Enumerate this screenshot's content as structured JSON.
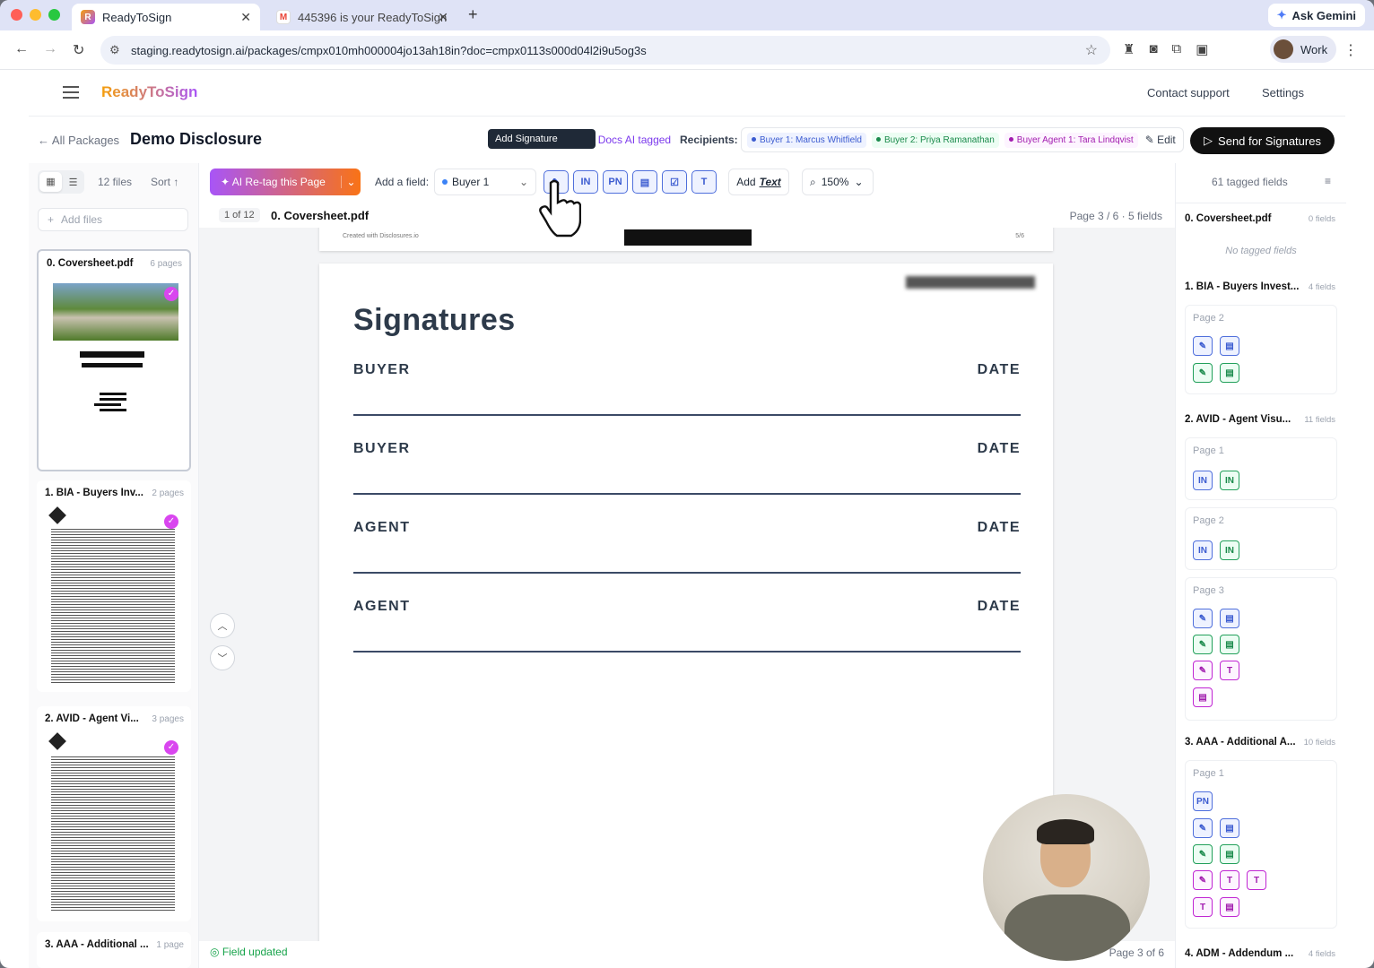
{
  "browser": {
    "tabs": [
      {
        "title": "ReadyToSign",
        "favicon": "R",
        "active": true
      },
      {
        "title": "445396 is your ReadyToSign",
        "favicon": "M",
        "active": false
      }
    ],
    "ask_gemini": "Ask Gemini",
    "url": "staging.readytosign.ai/packages/cmpx010mh000004jo13ah18in?doc=cmpx0113s000d04l2i9u5og3s",
    "profile": "Work"
  },
  "app": {
    "logo": "ReadyToSign",
    "contact_support": "Contact support",
    "settings": "Settings",
    "back_link": "All Packages",
    "package_title": "Demo Disclosure",
    "ai_tagged": "12/12 Docs AI tagged",
    "recipients_label": "Recipients:",
    "recipients": [
      {
        "label": "Buyer 1: Marcus Whitfield",
        "color": "#3b5bd0",
        "bg": "#eef2ff"
      },
      {
        "label": "Buyer 2: Priya Ramanathan",
        "color": "#1a8a4b",
        "bg": "#ecfdf3"
      },
      {
        "label": "Buyer Agent 1: Tara Lindqvist",
        "color": "#a21caf",
        "bg": "#fdf4ff"
      }
    ],
    "edit": "Edit",
    "send": "Send for Signatures"
  },
  "left": {
    "file_count": "12 files",
    "sort": "Sort",
    "add_files": "Add files",
    "files": [
      {
        "name": "0. Coversheet.pdf",
        "pages": "6 pages"
      },
      {
        "name": "1. BIA - Buyers Inv...",
        "pages": "2 pages"
      },
      {
        "name": "2. AVID - Agent Vi...",
        "pages": "3 pages"
      },
      {
        "name": "3. AAA - Additional ...",
        "pages": "1 page"
      }
    ]
  },
  "toolbar": {
    "retag": "AI Re-tag this Page",
    "add_field": "Add a field:",
    "recipient_select": "Buyer 1",
    "initials": "IN",
    "printed_name": "PN",
    "text_tool": "T",
    "add_text_a": "Add",
    "add_text_b": "Text",
    "zoom": "150%",
    "tooltip": "Add Signature"
  },
  "doc": {
    "page_of": "1 of 12",
    "name": "0. Coversheet.pdf",
    "info": "Page 3 / 6 · 5 fields",
    "prev_footer": "Created with Disclosures.io",
    "prev_page_num": "5/6",
    "title": "Signatures",
    "rows": [
      {
        "left": "BUYER",
        "right": "DATE"
      },
      {
        "left": "BUYER",
        "right": "DATE"
      },
      {
        "left": "AGENT",
        "right": "DATE"
      },
      {
        "left": "AGENT",
        "right": "DATE"
      }
    ],
    "status": "Field updated",
    "page_indicator": "Page 3 of 6"
  },
  "right": {
    "tagged": "61 tagged fields",
    "sections": [
      {
        "title": "0. Coversheet.pdf",
        "count": "0 fields",
        "empty": "No tagged fields"
      },
      {
        "title": "1. BIA - Buyers Invest...",
        "count": "4 fields"
      },
      {
        "title": "2. AVID - Agent Visu...",
        "count": "11 fields"
      },
      {
        "title": "3. AAA - Additional A...",
        "count": "10 fields"
      },
      {
        "title": "4. ADM - Addendum ...",
        "count": "4 fields"
      }
    ],
    "page1": "Page 1",
    "page2": "Page 2",
    "page3": "Page 3",
    "in": "IN",
    "pn": "PN",
    "t": "T"
  }
}
